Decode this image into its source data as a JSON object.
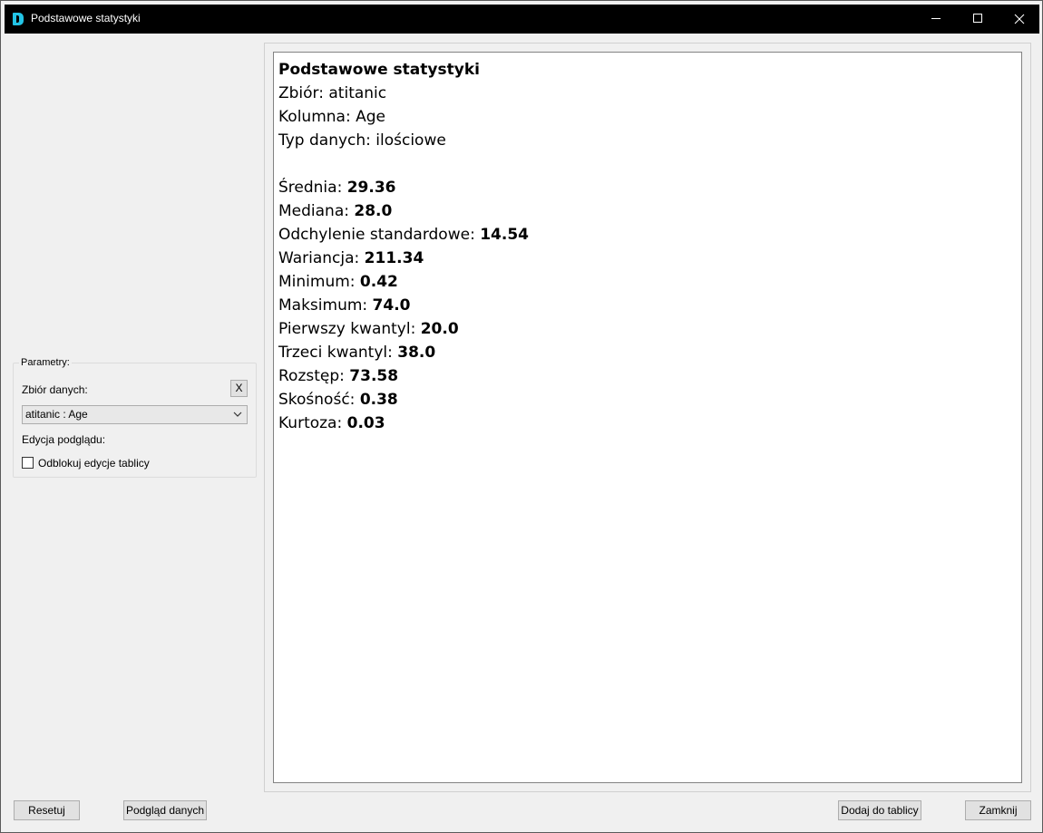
{
  "window": {
    "title": "Podstawowe statystyki"
  },
  "params": {
    "legend": "Parametry:",
    "dataset_label": "Zbiór danych:",
    "clear_button": "X",
    "dataset_value": "atitanic : Age",
    "preview_edit_label": "Edycja podglądu:",
    "unlock_label": "Odblokuj edycje tablicy",
    "unlock_checked": false
  },
  "report": {
    "title": "Podstawowe statystyki",
    "dataset": "Zbiór: atitanic",
    "column": "Kolumna: Age",
    "dtype": "Typ danych: ilościowe",
    "stats": [
      {
        "label": "Średnia: ",
        "value": "29.36"
      },
      {
        "label": "Mediana: ",
        "value": "28.0"
      },
      {
        "label": "Odchylenie standardowe: ",
        "value": "14.54"
      },
      {
        "label": "Wariancja: ",
        "value": "211.34"
      },
      {
        "label": "Minimum: ",
        "value": "0.42"
      },
      {
        "label": "Maksimum: ",
        "value": "74.0"
      },
      {
        "label": "Pierwszy kwantyl: ",
        "value": "20.0"
      },
      {
        "label": "Trzeci kwantyl: ",
        "value": "38.0"
      },
      {
        "label": "Rozstęp: ",
        "value": "73.58"
      },
      {
        "label": "Skośność: ",
        "value": "0.38"
      },
      {
        "label": "Kurtoza: ",
        "value": "0.03"
      }
    ]
  },
  "buttons": {
    "reset": "Resetuj",
    "preview": "Podgląd danych",
    "add": "Dodaj do tablicy",
    "close": "Zamknij"
  },
  "colors": {
    "titlebar": "#000000",
    "app_icon": "#23c4e6",
    "window_bg": "#f0f0f0",
    "button_bg": "#e1e1e1"
  }
}
